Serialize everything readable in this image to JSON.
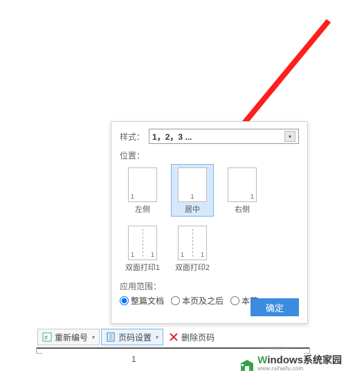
{
  "panel": {
    "style_label": "样式：",
    "style_value": "1，2，3 ...",
    "position_label": "位置：",
    "positions": [
      {
        "label": "左侧"
      },
      {
        "label": "居中"
      },
      {
        "label": "右侧"
      },
      {
        "label": "双面打印1"
      },
      {
        "label": "双面打印2"
      }
    ],
    "selected_position_index": 1,
    "scope_label": "应用范围：",
    "scope_options": [
      {
        "label": "整篇文档"
      },
      {
        "label": "本页及之后"
      },
      {
        "label": "本节"
      }
    ],
    "scope_selected_index": 0,
    "ok_label": "确定"
  },
  "toolbar": {
    "renumber": {
      "label": "重新编号"
    },
    "page_setup": {
      "label": "页码设置"
    },
    "delete_pn": {
      "label": "删除页码"
    }
  },
  "page_number_below": "1",
  "icons": {
    "renumber": "renumber-icon",
    "page_setup": "page-setup-icon",
    "delete": "delete-icon",
    "dropdown": "chevron-down-icon"
  },
  "watermark": {
    "text1_prefix": "W",
    "text1_rest": "indows",
    "text1_cn": "系统家园",
    "text2": "www.ruihaifu.com"
  },
  "colors": {
    "accent": "#3b8cde",
    "select_bg": "#d6e8fb",
    "select_border": "#7ab4ea",
    "arrow": "#ff1e1e",
    "wm_green": "#35a24a"
  }
}
